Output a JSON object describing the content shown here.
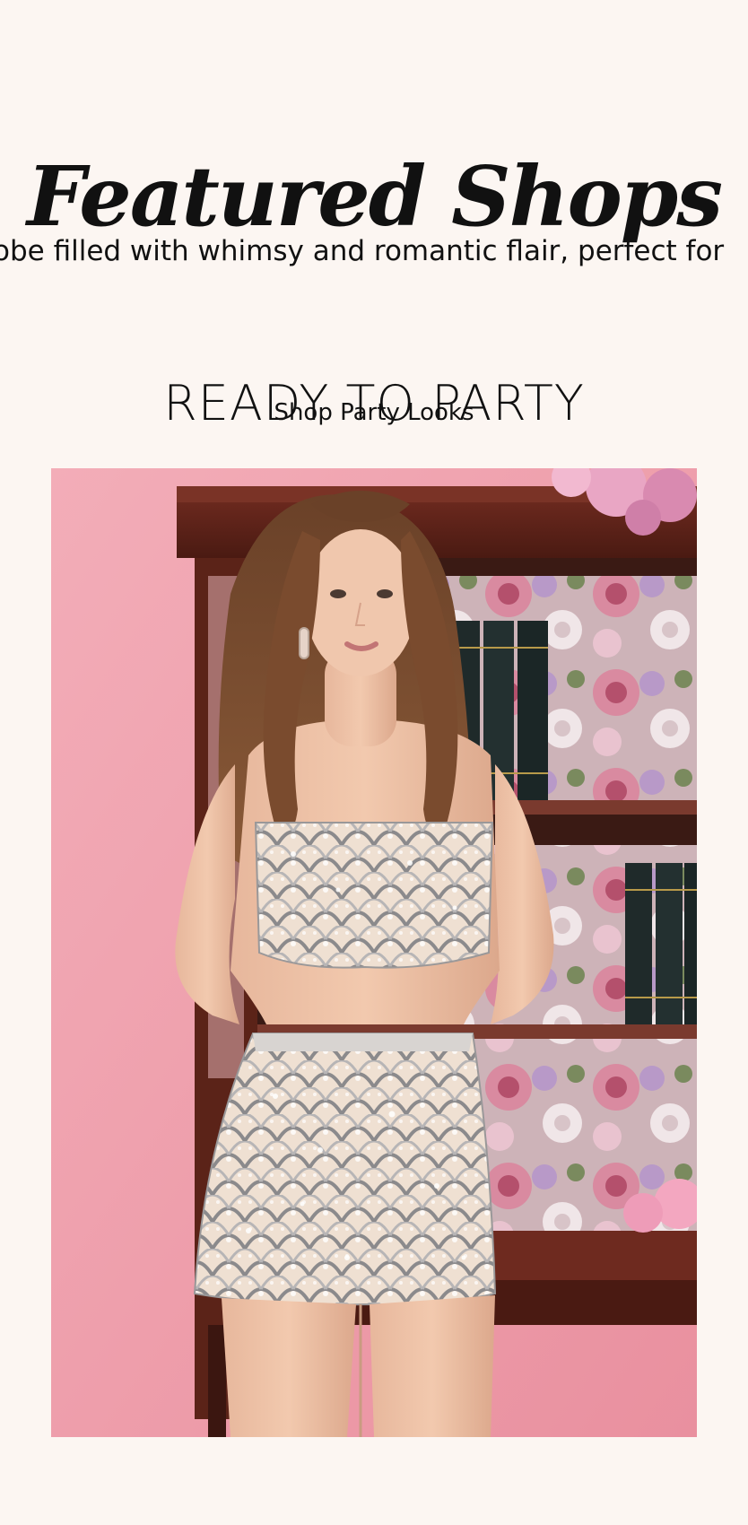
{
  "featured": {
    "title": "Featured Shops",
    "marquee": "obe filled with whimsy and romantic flair, perfect for"
  },
  "promo": {
    "heading": "READY TO PARTY",
    "link_label": "Shop Party Looks",
    "image_alt": "Model in silver sequin scalloped crop top and mini skirt in front of a floral bookcase"
  },
  "colors": {
    "background": "#fcf6f2",
    "text": "#111111",
    "photo_wall": "#f0a8b4"
  }
}
